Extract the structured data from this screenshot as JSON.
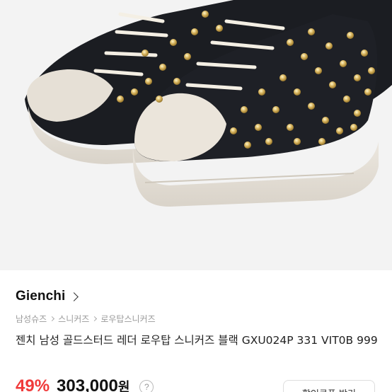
{
  "product_image": {
    "alt": ""
  },
  "brand": {
    "name": "Gienchi"
  },
  "breadcrumb": [
    "남성슈즈",
    "스니커즈",
    "로우탑스니커즈"
  ],
  "product": {
    "title": "젠치 남성 골드스터드 레더 로우탑 스니커즈 블랙 GXU024P 331 VIT0B 999",
    "discount": "49%",
    "price": "303,000",
    "currency": "원",
    "help_symbol": "?"
  },
  "coupon_button": {
    "label": "할인쿠폰 받기"
  },
  "colors": {
    "discount": "#f03a3a",
    "background_hero": "#f3f3f3"
  },
  "icons": {
    "brand_chevron": "chevron-right-icon",
    "help": "question-circle-icon"
  }
}
